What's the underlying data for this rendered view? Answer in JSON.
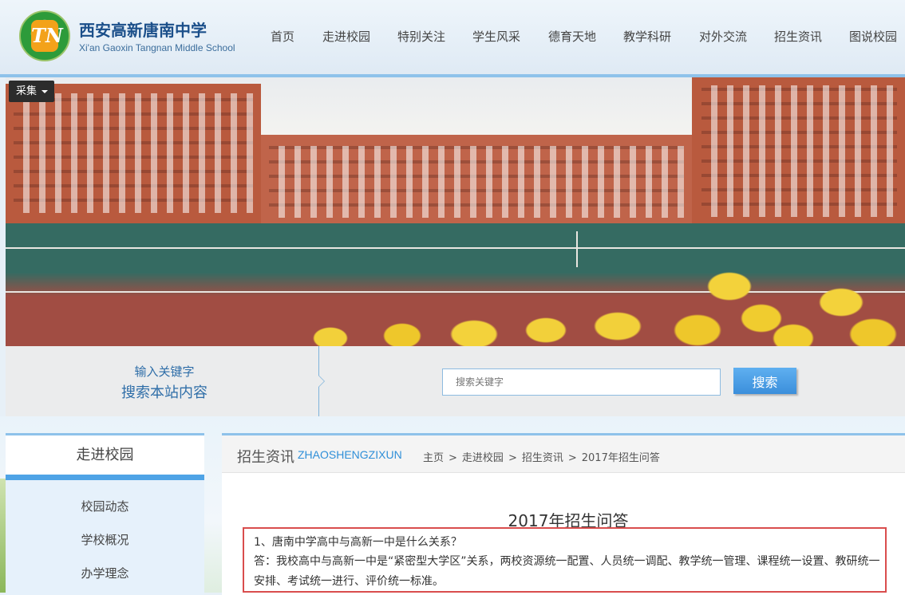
{
  "header": {
    "school_name_cn": "西安高新唐南中学",
    "school_name_en": "Xi'an Gaoxin Tangnan Middle School",
    "logo_mark": "TN"
  },
  "nav": {
    "items": [
      {
        "label": "首页"
      },
      {
        "label": "走进校园"
      },
      {
        "label": "特别关注"
      },
      {
        "label": "学生风采"
      },
      {
        "label": "德育天地"
      },
      {
        "label": "教学科研"
      },
      {
        "label": "对外交流"
      },
      {
        "label": "招生资讯"
      },
      {
        "label": "图说校园"
      }
    ]
  },
  "banner": {
    "collect_label": "采集"
  },
  "search": {
    "prompt_small": "输入关键字",
    "prompt_big": "搜索本站内容",
    "placeholder": "搜索关键字",
    "button_label": "搜索"
  },
  "sidebar": {
    "title": "走进校园",
    "items": [
      {
        "label": "校园动态"
      },
      {
        "label": "学校概况"
      },
      {
        "label": "办学理念"
      }
    ]
  },
  "main": {
    "section_title": "招生资讯",
    "section_title_en": "ZHAOSHENGZIXUN",
    "breadcrumb": [
      "主页",
      ">",
      "走进校园",
      ">",
      "招生资讯",
      ">",
      "2017年招生问答"
    ],
    "article_title": "2017年招生问答",
    "question": "1、唐南中学高中与高新一中是什么关系？",
    "answer": "答：我校高中与高新一中是“紧密型大学区”关系，两校资源统一配置、人员统一调配、教学统一管理、课程统一设置、教研统一安排、考试统一进行、评价统一标准。"
  },
  "colors": {
    "accent": "#4ea3e6",
    "brand_text": "#1b4f8a",
    "highlight_border": "#d94d4d"
  }
}
